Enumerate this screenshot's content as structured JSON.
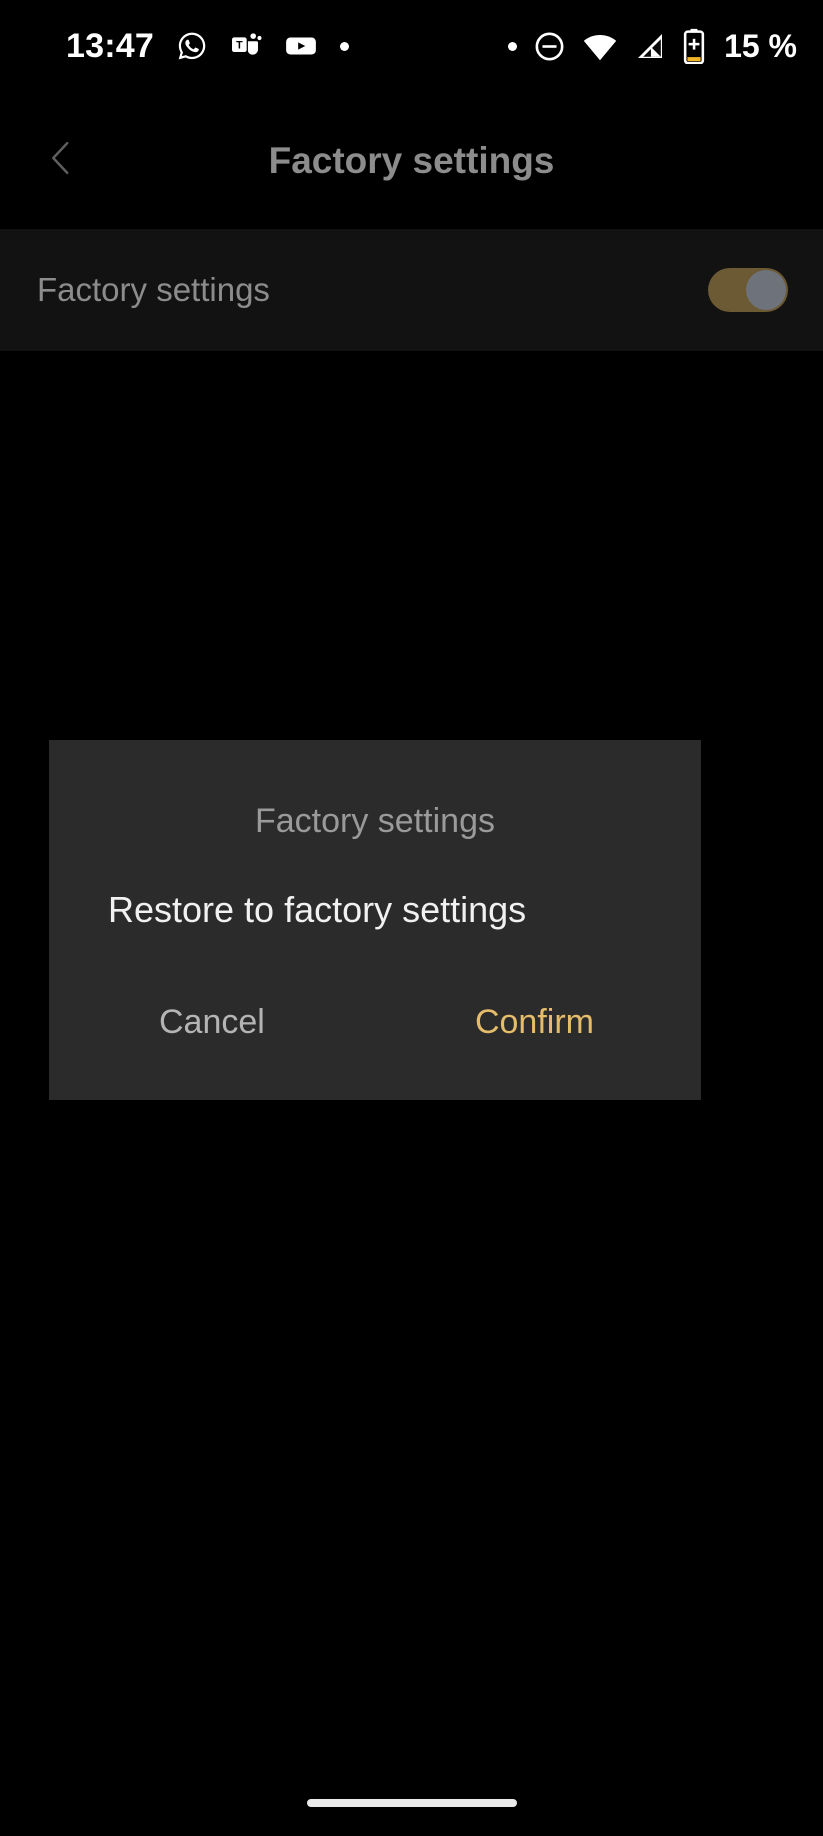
{
  "status_bar": {
    "time": "13:47",
    "battery_percent": "15 %",
    "left_icons": [
      "whatsapp-icon",
      "microsoft-teams-icon",
      "youtube-icon",
      "notification-dot-icon"
    ],
    "right_icons": [
      "notification-dot-icon",
      "do-not-disturb-icon",
      "wifi-icon",
      "cellular-signal-icon",
      "battery-charging-icon"
    ],
    "battery_accent_color": "#f0b429"
  },
  "app_bar": {
    "back_icon": "chevron-left-icon",
    "title": "Factory settings"
  },
  "settings_row": {
    "label": "Factory settings",
    "toggle_state": "on",
    "toggle_track_color": "#6b5a33",
    "toggle_knob_color": "#6e727a"
  },
  "dialog": {
    "title": "Factory settings",
    "message": "Restore to factory settings",
    "cancel_label": "Cancel",
    "confirm_label": "Confirm",
    "confirm_color": "#e4bc6a",
    "background_color": "#2b2b2b"
  },
  "nav_bar": {
    "home_indicator": "home-gesture-bar"
  }
}
